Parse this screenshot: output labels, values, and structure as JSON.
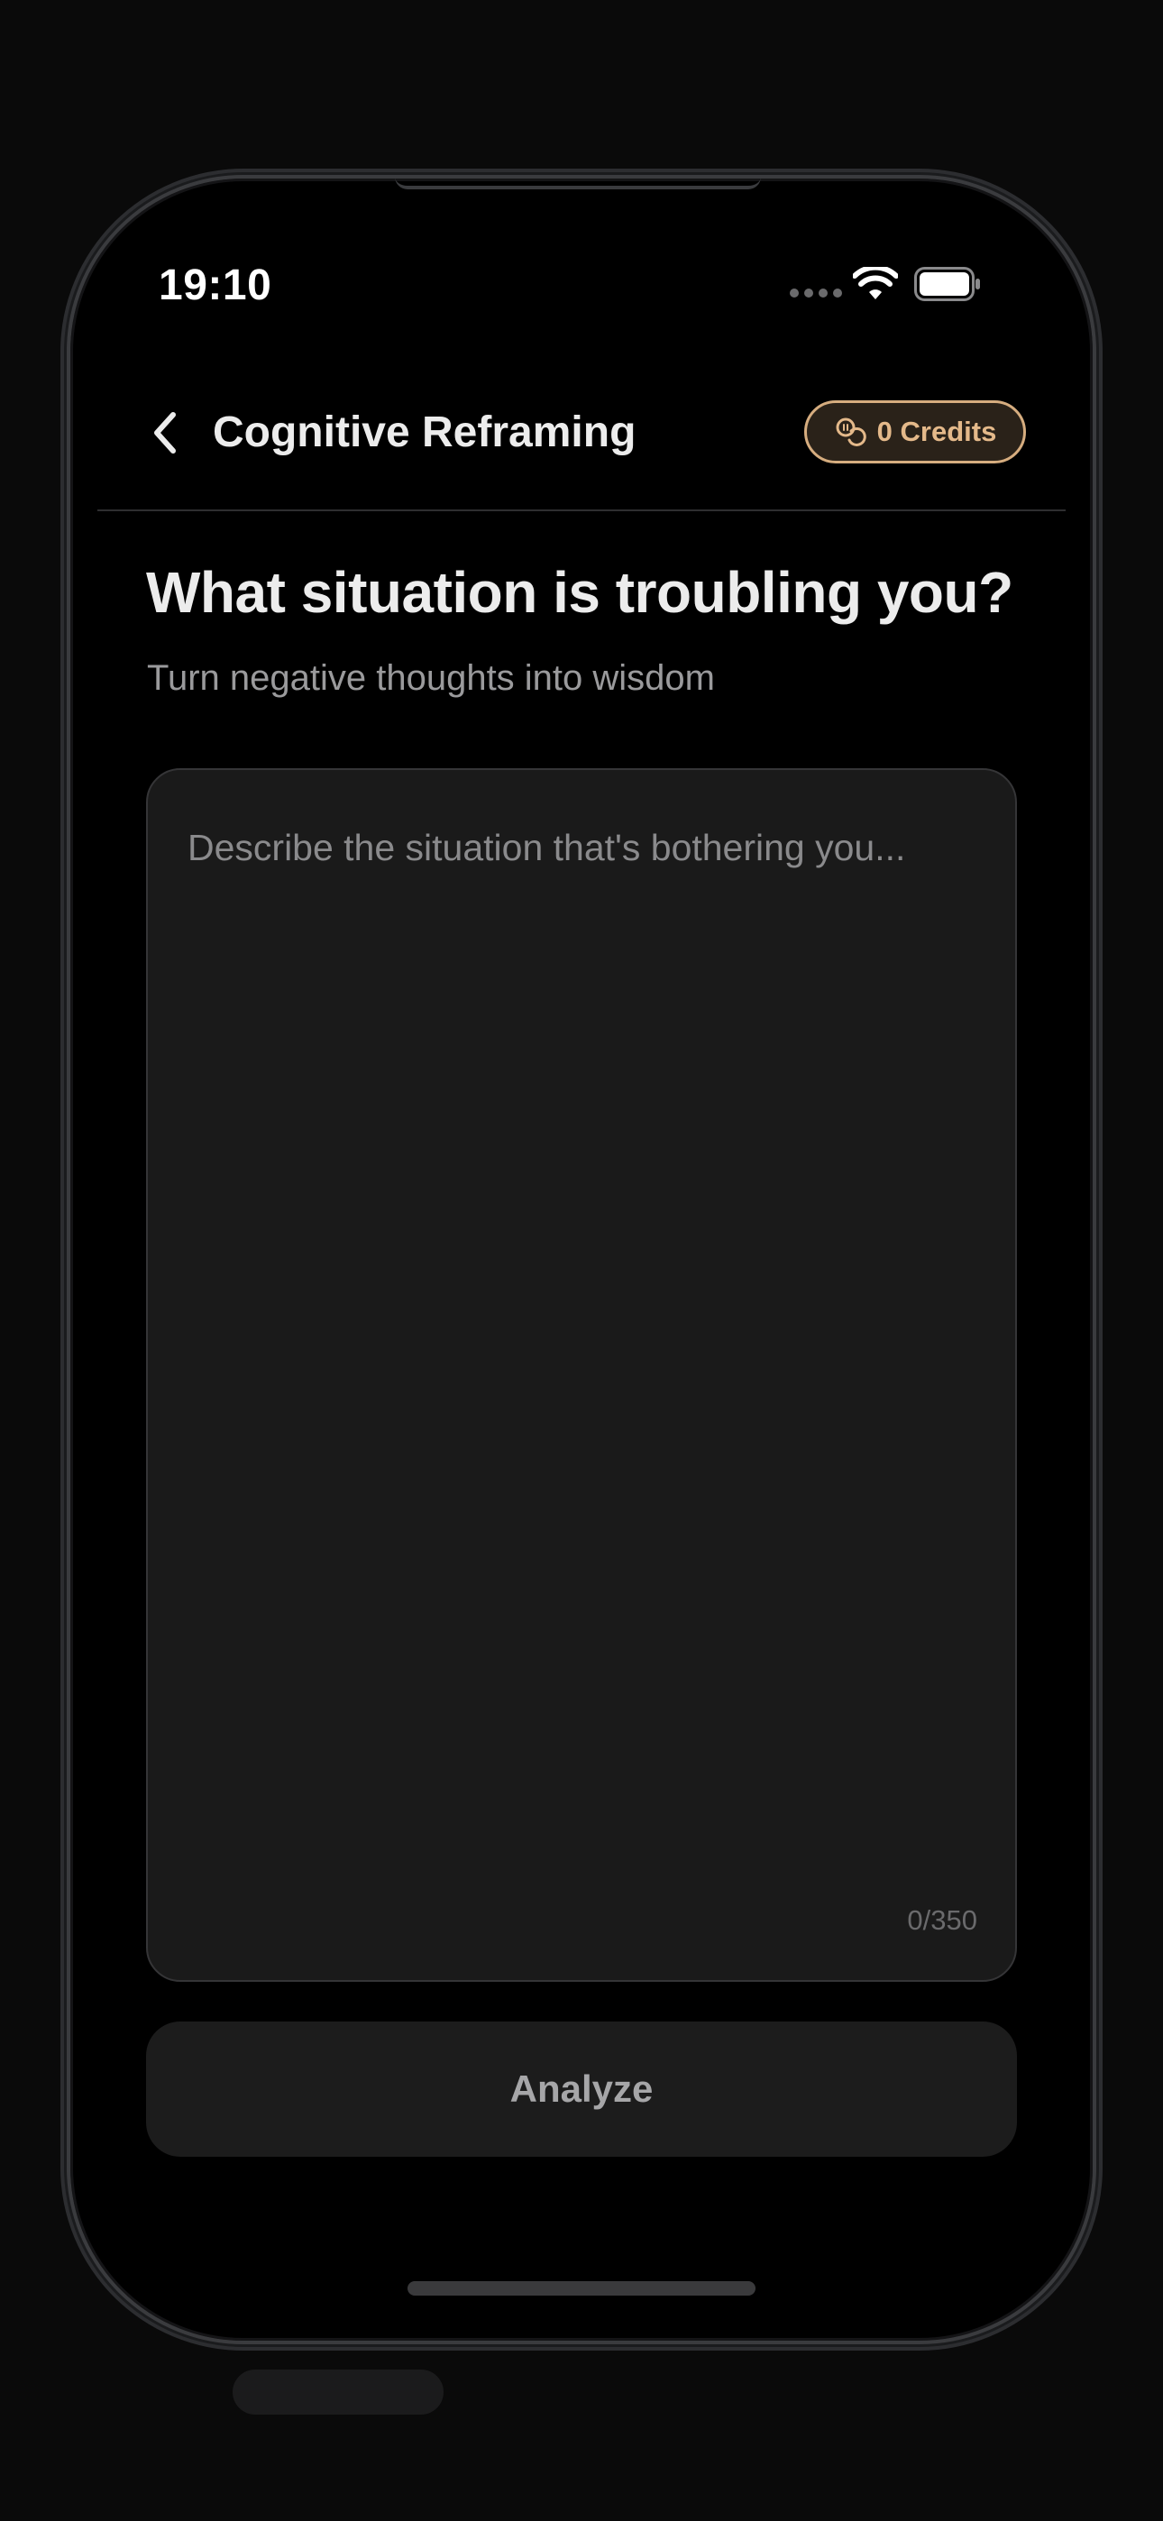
{
  "status_bar": {
    "time": "19:10",
    "icons": [
      "cellular-dots-icon",
      "wifi-icon",
      "battery-icon"
    ]
  },
  "header": {
    "back_icon": "chevron-left-icon",
    "title": "Cognitive Reframing",
    "credits": {
      "icon": "coins-icon",
      "label": "0 Credits"
    }
  },
  "main": {
    "question": "What situation is troubling you?",
    "subtitle": "Turn negative thoughts into wisdom",
    "situation_input": {
      "placeholder": "Describe the situation that's bothering you...",
      "value": "",
      "char_count": "0/350"
    },
    "analyze_label": "Analyze"
  },
  "colors": {
    "background": "#000000",
    "input_background": "#1a1a1a",
    "accent_gold": "#d6ad7f",
    "text_primary": "#ececec",
    "text_secondary": "#9a9a9c"
  }
}
